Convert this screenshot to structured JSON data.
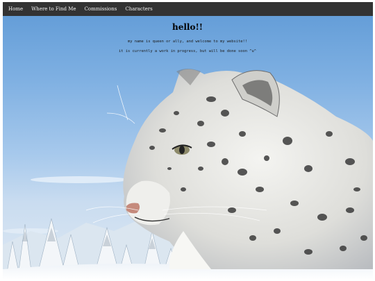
{
  "nav": {
    "items": [
      "Home",
      "Where to Find Me",
      "Commissions",
      "Characters"
    ]
  },
  "main": {
    "heading": "hello!!",
    "intro_line_1": "my name is queen or ally, and welcome to my website!!",
    "intro_line_2": "it is currently a work in progress, but will be done soon ^u^"
  },
  "background": {
    "subject": "snow leopard over snowy forest",
    "colors": {
      "navbar": "#333333",
      "sky": "#7fb0e2",
      "snow": "#f2f5f8",
      "fur": "#e6e6e2"
    }
  }
}
